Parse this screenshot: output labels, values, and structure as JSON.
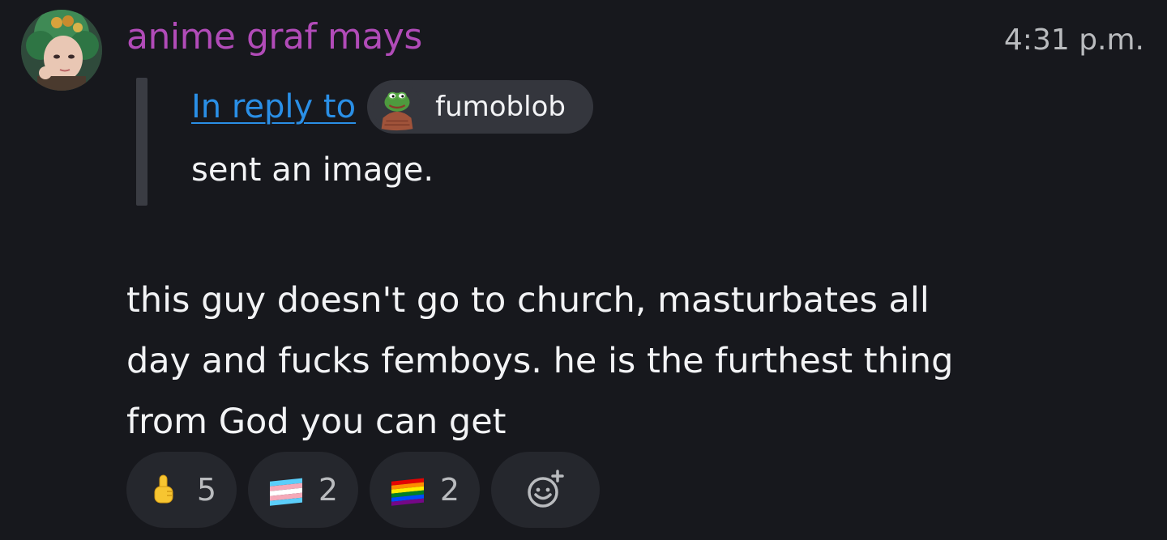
{
  "message": {
    "author": "anime graf mays",
    "author_color": "#b14bb8",
    "timestamp": "4:31 p.m.",
    "reply": {
      "link_text": "In reply to",
      "mention_name": "fumoblob",
      "preview_text": "sent an image."
    },
    "body_lines": [
      "this guy doesn't go to church, masturbates all",
      "day and fucks femboys. he is the furthest thing",
      "from God you can get"
    ],
    "reactions": [
      {
        "icon": "pointing-up-emoji",
        "count": "5"
      },
      {
        "icon": "transgender-flag-emoji",
        "count": "2"
      },
      {
        "icon": "rainbow-flag-emoji",
        "count": "2"
      }
    ],
    "add_reaction_icon": "add-reaction-icon"
  },
  "colors": {
    "background": "#17181d",
    "link": "#2a8fe6",
    "chip": "#34363d",
    "reaction_bg": "#25272d",
    "muted_text": "#b9bbbe"
  }
}
